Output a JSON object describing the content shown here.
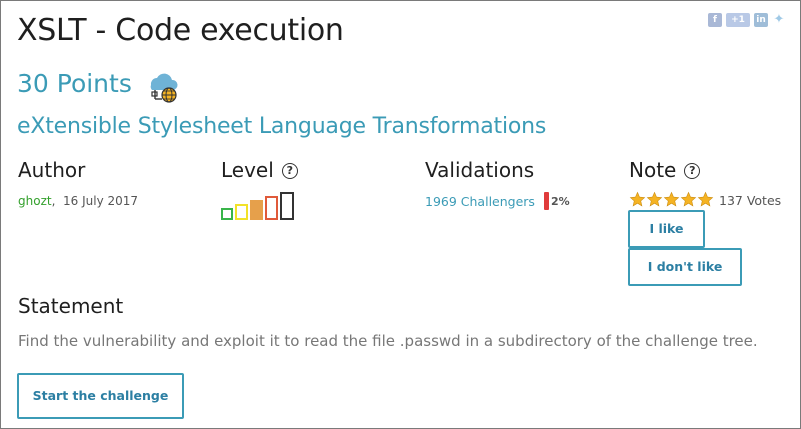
{
  "challenge": {
    "title": "XSLT - Code execution",
    "points": "30 Points",
    "category": "eXtensible Stylesheet Language Transformations",
    "category_icon": "cloud-network-globe-icon"
  },
  "share": {
    "icons": [
      "facebook-icon",
      "google-plus-icon",
      "linkedin-icon",
      "twitter-icon"
    ],
    "google_plus_label": "+1"
  },
  "author": {
    "heading": "Author",
    "name": "ghozt",
    "separator": ",",
    "date": "16 July 2017"
  },
  "level": {
    "heading": "Level",
    "help_icon": "question-mark-icon",
    "help_glyph": "?",
    "current_level": 4,
    "max_level": 5,
    "colors": [
      "#39b54a",
      "#f2e229",
      "#e6a04b",
      "#e05a3a",
      "#333333"
    ]
  },
  "validations": {
    "heading": "Validations",
    "challengers": "1969 Challengers",
    "percent": "2%",
    "percent_color": "#e03b3b"
  },
  "note": {
    "heading": "Note",
    "help_glyph": "?",
    "stars": 5,
    "star_color": "#f5b323",
    "votes": "137 Votes",
    "like_label": "I like",
    "dislike_label": "I don't like"
  },
  "statement": {
    "heading": "Statement",
    "text": "Find the vulnerability and exploit it to read the file .passwd in a subdirectory of the challenge tree."
  },
  "actions": {
    "start_label": "Start the challenge"
  },
  "colors": {
    "accent": "#3b9bb6",
    "author_link": "#33a02c"
  }
}
